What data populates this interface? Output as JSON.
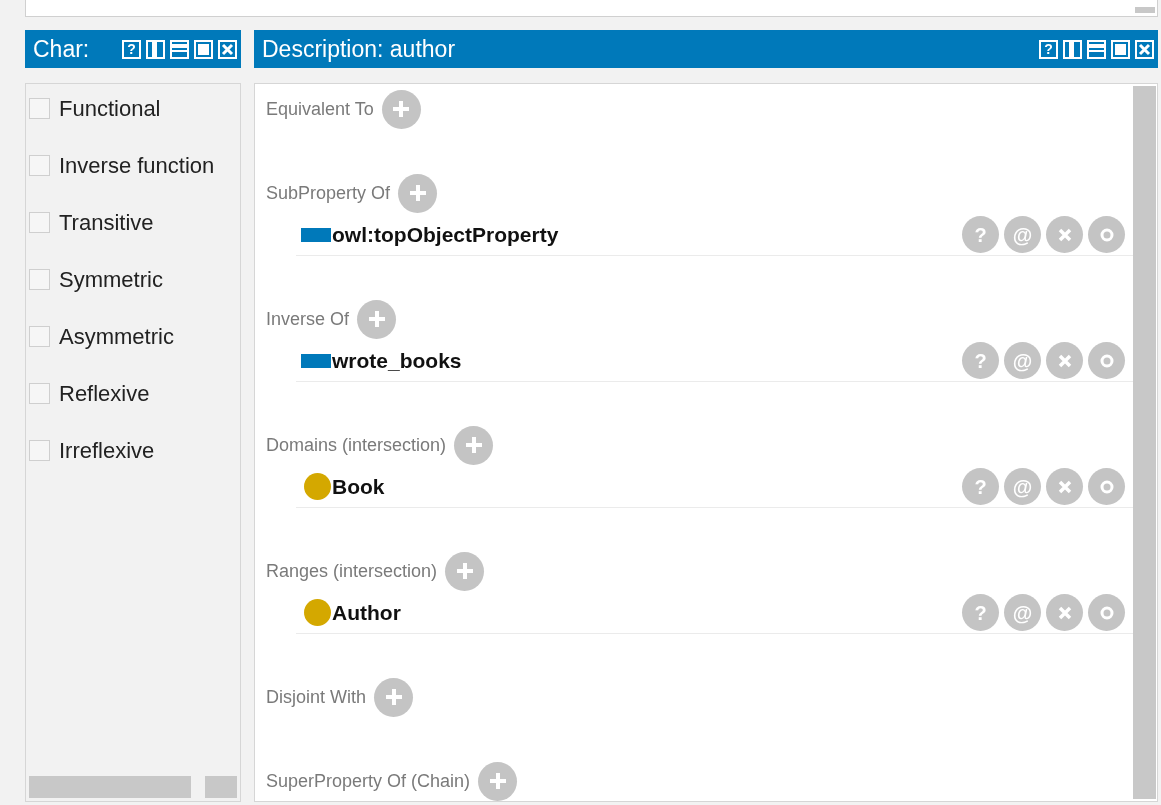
{
  "characteristics_panel": {
    "title": "Char:",
    "buttons": [
      {
        "kind": "help",
        "label": "?"
      },
      {
        "kind": "split-vertical"
      },
      {
        "kind": "split-horizontal"
      },
      {
        "kind": "maximize"
      },
      {
        "kind": "close"
      }
    ],
    "items": [
      {
        "label": "Functional",
        "checked": false
      },
      {
        "label": "Inverse function",
        "checked": false
      },
      {
        "label": "Transitive",
        "checked": false
      },
      {
        "label": "Symmetric",
        "checked": false
      },
      {
        "label": "Asymmetric",
        "checked": false
      },
      {
        "label": "Reflexive",
        "checked": false
      },
      {
        "label": "Irreflexive",
        "checked": false
      }
    ]
  },
  "description_panel": {
    "title": "Description: author",
    "buttons": [
      {
        "kind": "help",
        "label": "?"
      },
      {
        "kind": "split-vertical"
      },
      {
        "kind": "split-horizontal"
      },
      {
        "kind": "maximize"
      },
      {
        "kind": "close"
      }
    ],
    "sections": [
      {
        "label": "Equivalent To"
      },
      {
        "label": "SubProperty Of",
        "entries": [
          {
            "kind": "property",
            "label": "owl:topObjectProperty"
          }
        ]
      },
      {
        "label": "Inverse Of",
        "entries": [
          {
            "kind": "property",
            "label": "wrote_books"
          }
        ]
      },
      {
        "label": "Domains (intersection)",
        "entries": [
          {
            "kind": "class",
            "label": "Book"
          }
        ]
      },
      {
        "label": "Ranges (intersection)",
        "entries": [
          {
            "kind": "class",
            "label": "Author"
          }
        ]
      },
      {
        "label": "Disjoint With"
      },
      {
        "label": "SuperProperty Of (Chain)"
      }
    ],
    "entry_actions": [
      {
        "kind": "text",
        "label": "?"
      },
      {
        "kind": "text",
        "label": "@"
      },
      {
        "kind": "delete"
      },
      {
        "kind": "ring"
      }
    ]
  }
}
